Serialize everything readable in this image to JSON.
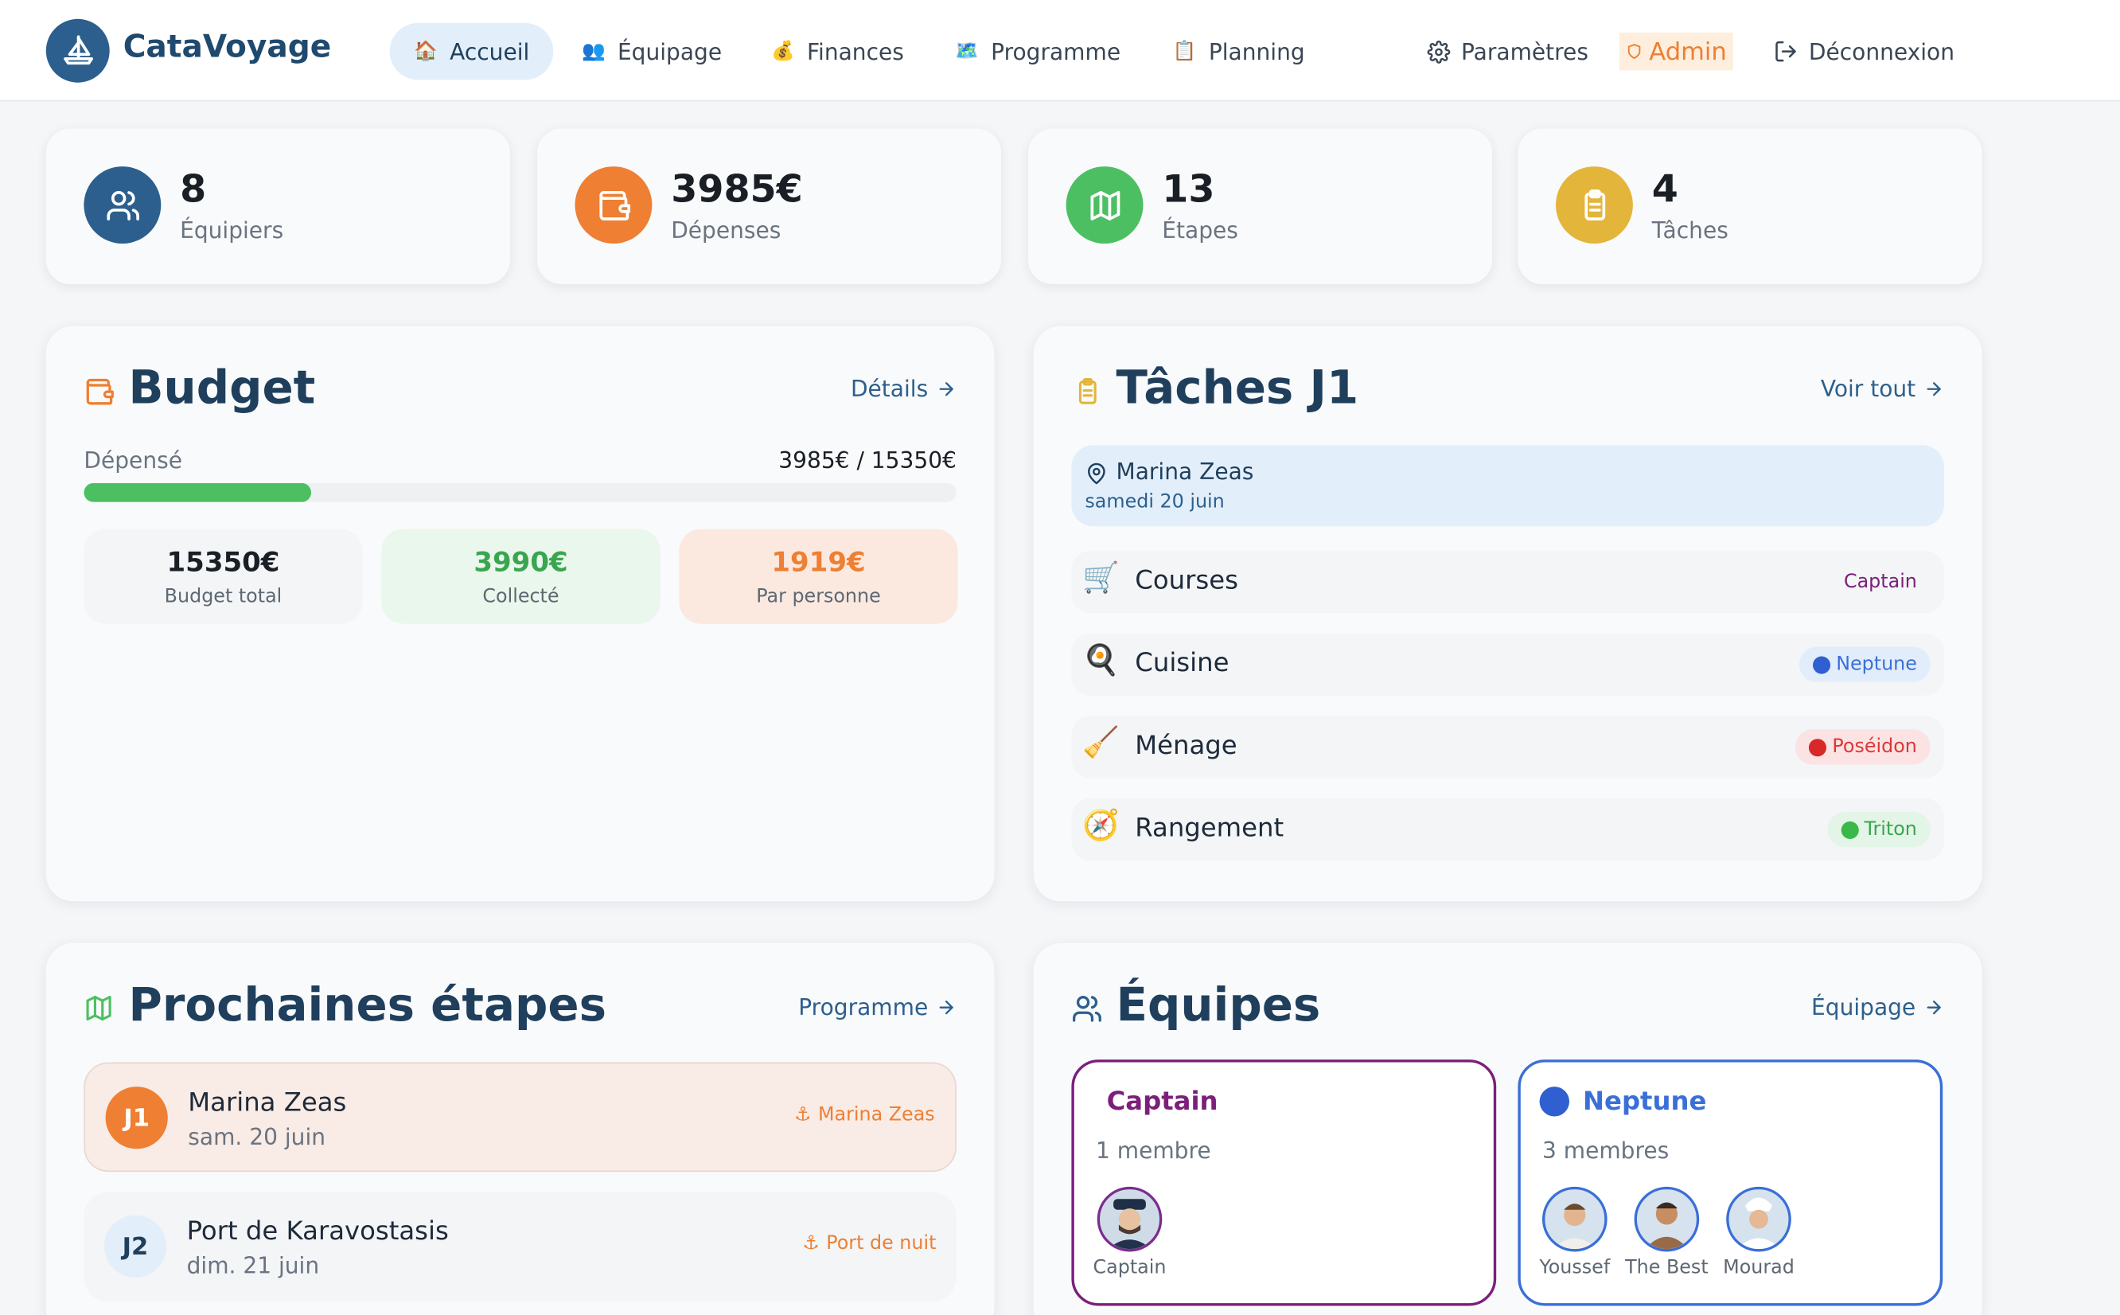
{
  "app": {
    "name": "CataVoyage"
  },
  "nav": {
    "items": [
      {
        "label": "Accueil",
        "emoji": "🏠",
        "active": true
      },
      {
        "label": "Équipage",
        "emoji": "👥"
      },
      {
        "label": "Finances",
        "emoji": "💰"
      },
      {
        "label": "Programme",
        "emoji": "🗺️"
      },
      {
        "label": "Planning",
        "emoji": "📋"
      }
    ],
    "settings": "Paramètres",
    "admin": "Admin",
    "logout": "Déconnexion"
  },
  "stats": [
    {
      "value": "8",
      "label": "Équipiers",
      "icon": "users-icon",
      "color": "#2c5f8d"
    },
    {
      "value": "3985€",
      "label": "Dépenses",
      "icon": "wallet-icon",
      "color": "#ee7f33"
    },
    {
      "value": "13",
      "label": "Étapes",
      "icon": "map-icon",
      "color": "#4cbf62"
    },
    {
      "value": "4",
      "label": "Tâches",
      "icon": "clipboard-icon",
      "color": "#e3b53a"
    }
  ],
  "budget": {
    "title": "Budget",
    "link": "Détails",
    "spent_label": "Dépensé",
    "spent_value": "3985€ / 15350€",
    "progress_fraction": 0.26,
    "boxes": [
      {
        "value": "15350€",
        "label": "Budget total"
      },
      {
        "value": "3990€",
        "label": "Collecté"
      },
      {
        "value": "1919€",
        "label": "Par personne"
      }
    ]
  },
  "tasks": {
    "title": "Tâches J1",
    "link": "Voir tout",
    "location": {
      "name": "Marina Zeas",
      "date": "samedi 20 juin"
    },
    "items": [
      {
        "icon": "🛒",
        "name": "Courses",
        "team": "Captain"
      },
      {
        "icon": "🍳",
        "name": "Cuisine",
        "team": "Neptune"
      },
      {
        "icon": "🧹",
        "name": "Ménage",
        "team": "Poséidon"
      },
      {
        "icon": "🧭",
        "name": "Rangement",
        "team": "Triton"
      }
    ]
  },
  "steps": {
    "title": "Prochaines étapes",
    "link": "Programme",
    "items": [
      {
        "badge": "J1",
        "name": "Marina Zeas",
        "date": "sam. 20 juin",
        "tag": "Marina Zeas"
      },
      {
        "badge": "J2",
        "name": "Port de Karavostasis",
        "date": "dim. 21 juin",
        "tag": "Port de nuit"
      }
    ]
  },
  "teams": {
    "title": "Équipes",
    "link": "Équipage",
    "items": [
      {
        "name": "Captain",
        "count": "1 membre",
        "members": [
          "Captain"
        ]
      },
      {
        "name": "Neptune",
        "count": "3 membres",
        "members": [
          "Youssef",
          "The Best",
          "Mourad"
        ]
      }
    ]
  },
  "colors": {
    "primary": "#2c5f8d",
    "orange": "#ee7f33",
    "green": "#4cbf62",
    "yellow": "#e3b53a",
    "purple": "#7b1f7a",
    "blue": "#3a6fd8",
    "red": "#e04040"
  }
}
